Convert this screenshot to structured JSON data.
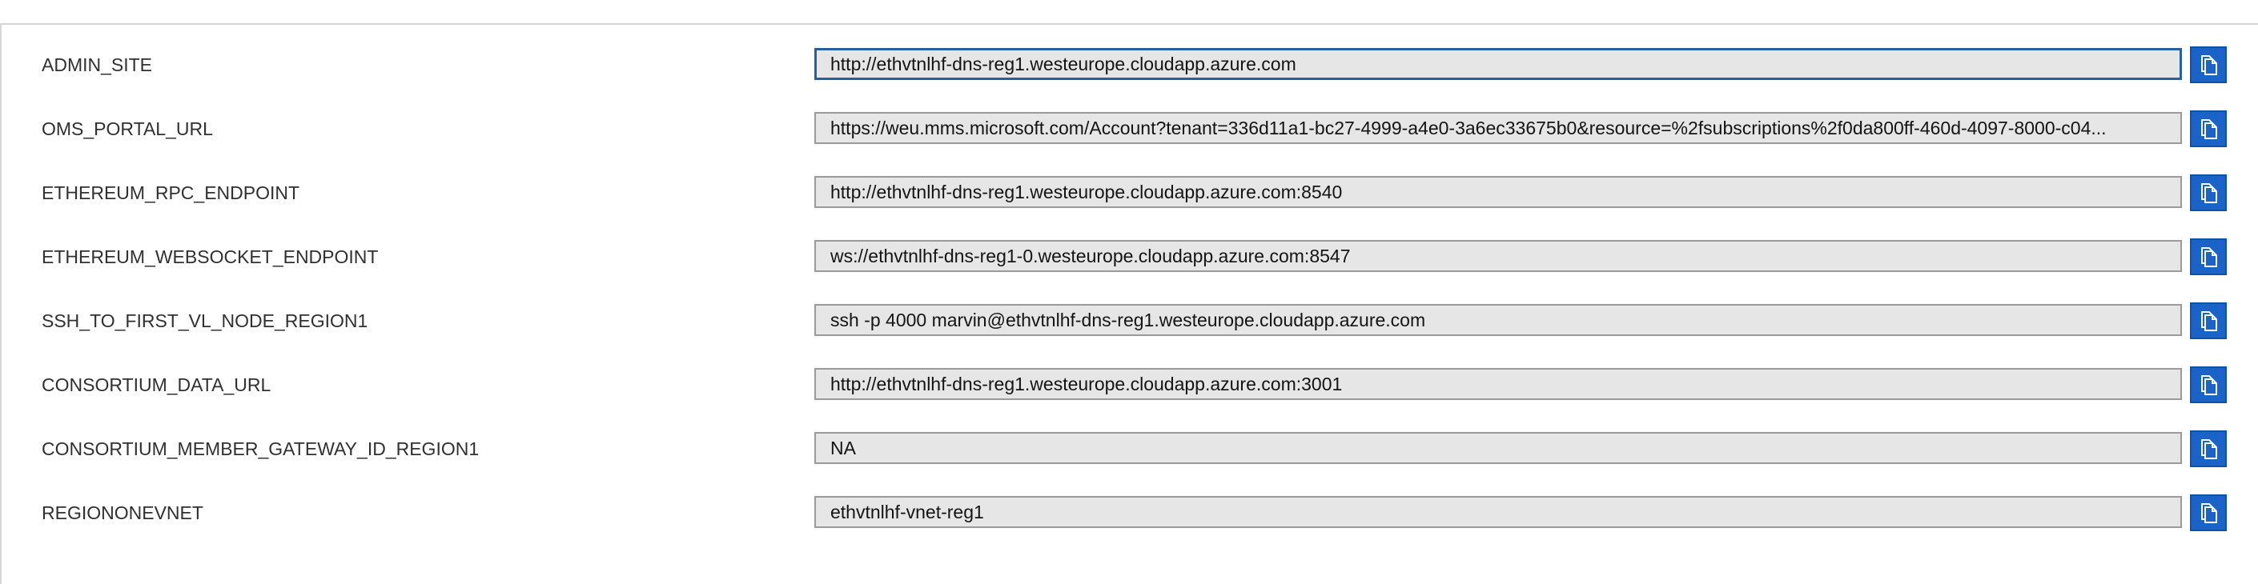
{
  "colors": {
    "copy_button_bg": "#1c63c8",
    "field_bg": "#e6e6e6",
    "focused_border": "#2a5f9e"
  },
  "outputs": [
    {
      "key": "ADMIN_SITE",
      "value": "http://ethvtnlhf-dns-reg1.westeurope.cloudapp.azure.com",
      "focused": true,
      "copy_icon": "copy-icon"
    },
    {
      "key": "OMS_PORTAL_URL",
      "value": "https://weu.mms.microsoft.com/Account?tenant=336d11a1-bc27-4999-a4e0-3a6ec33675b0&resource=%2fsubscriptions%2f0da800ff-460d-4097-8000-c04...",
      "focused": false,
      "copy_icon": "copy-icon"
    },
    {
      "key": "ETHEREUM_RPC_ENDPOINT",
      "value": "http://ethvtnlhf-dns-reg1.westeurope.cloudapp.azure.com:8540",
      "focused": false,
      "copy_icon": "copy-icon"
    },
    {
      "key": "ETHEREUM_WEBSOCKET_ENDPOINT",
      "value": "ws://ethvtnlhf-dns-reg1-0.westeurope.cloudapp.azure.com:8547",
      "focused": false,
      "copy_icon": "copy-icon"
    },
    {
      "key": "SSH_TO_FIRST_VL_NODE_REGION1",
      "value": "ssh -p 4000 marvin@ethvtnlhf-dns-reg1.westeurope.cloudapp.azure.com",
      "focused": false,
      "copy_icon": "copy-icon"
    },
    {
      "key": "CONSORTIUM_DATA_URL",
      "value": "http://ethvtnlhf-dns-reg1.westeurope.cloudapp.azure.com:3001",
      "focused": false,
      "copy_icon": "copy-icon"
    },
    {
      "key": "CONSORTIUM_MEMBER_GATEWAY_ID_REGION1",
      "value": "NA",
      "focused": false,
      "copy_icon": "copy-icon"
    },
    {
      "key": "REGIONONEVNET",
      "value": "ethvtnlhf-vnet-reg1",
      "focused": false,
      "copy_icon": "copy-icon"
    }
  ]
}
